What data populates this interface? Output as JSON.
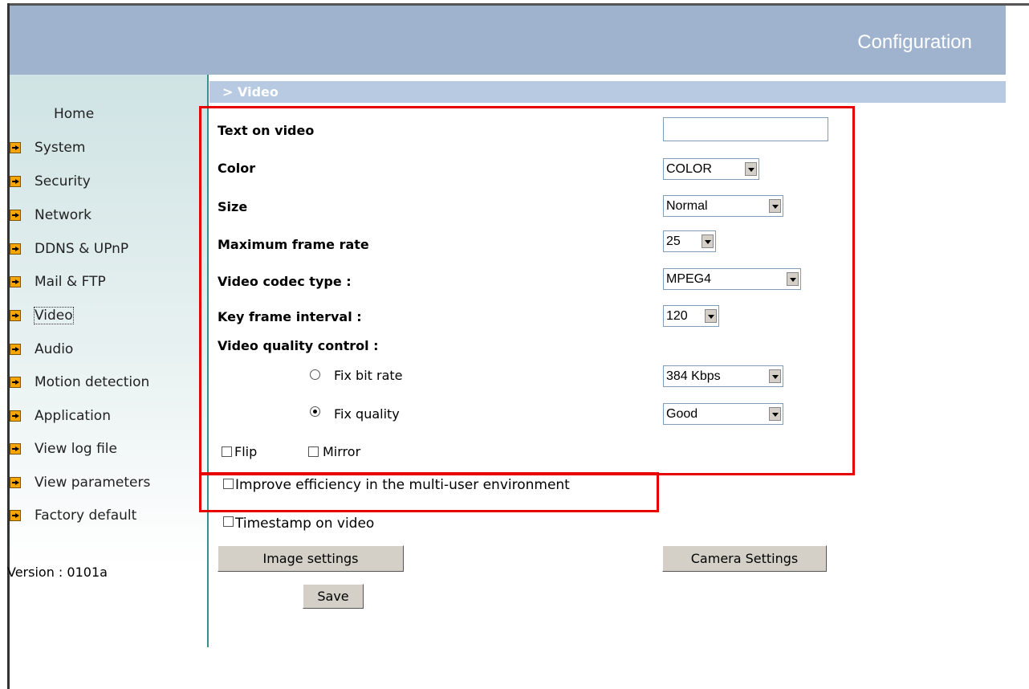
{
  "header": {
    "title": "Configuration"
  },
  "breadcrumb": "> Video",
  "sidebar": {
    "home": "Home",
    "items": [
      "System",
      "Security",
      "Network",
      "DDNS & UPnP",
      "Mail & FTP",
      "Video",
      "Audio",
      "Motion detection",
      "Application",
      "View log file",
      "View parameters",
      "Factory default"
    ],
    "version": "Version : 0101a"
  },
  "form": {
    "text_on_video": {
      "label": "Text on video",
      "value": ""
    },
    "color": {
      "label": "Color",
      "value": "COLOR"
    },
    "size": {
      "label": "Size",
      "value": "Normal"
    },
    "max_frame_rate": {
      "label": "Maximum frame rate",
      "value": "25"
    },
    "codec": {
      "label": "Video codec type :",
      "value": "MPEG4"
    },
    "key_frame": {
      "label": "Key frame interval :",
      "value": "120"
    },
    "quality_control": {
      "label": "Video quality control :"
    },
    "fix_bit_rate": {
      "label": "Fix bit rate",
      "value": "384 Kbps",
      "selected": false
    },
    "fix_quality": {
      "label": "Fix quality",
      "value": "Good",
      "selected": true
    },
    "flip": {
      "label": "Flip",
      "checked": false
    },
    "mirror": {
      "label": "Mirror",
      "checked": false
    },
    "improve_efficiency": {
      "label": "Improve efficiency in the multi-user environment",
      "checked": false
    },
    "timestamp": {
      "label": "Timestamp on video",
      "checked": false
    }
  },
  "buttons": {
    "image_settings": "Image settings",
    "camera_settings": "Camera  Settings",
    "save": "Save"
  },
  "colors": {
    "header": "#9fb3cf",
    "breadcrumb": "#b8cae1",
    "highlight_box": "#e60000",
    "sidebar_line": "#3a8f8e"
  }
}
